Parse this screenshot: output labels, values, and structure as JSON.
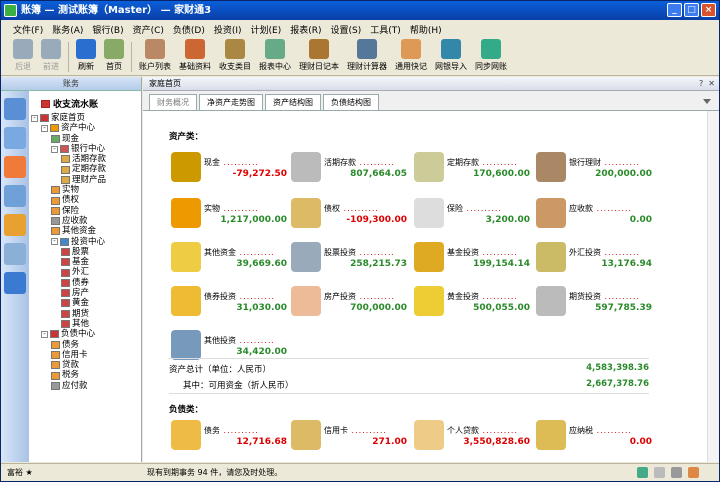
{
  "window": {
    "title": "账簿 — 测试账簿（Master） — 家财通3"
  },
  "menu": [
    "文件(F)",
    "账务(A)",
    "银行(B)",
    "资产(C)",
    "负债(D)",
    "投资(I)",
    "计划(E)",
    "报表(R)",
    "设置(S)",
    "工具(T)",
    "帮助(H)"
  ],
  "toolbar": [
    {
      "label": "后退",
      "icon": "back-arrow-icon",
      "enabled": false
    },
    {
      "label": "前进",
      "icon": "forward-arrow-icon",
      "enabled": false
    },
    {
      "label": "刷新",
      "icon": "refresh-icon",
      "enabled": true
    },
    {
      "label": "首页",
      "icon": "home-icon",
      "enabled": true
    },
    {
      "label": "账户列表",
      "icon": "account-list-icon",
      "enabled": true
    },
    {
      "label": "基础资料",
      "icon": "basic-data-icon",
      "enabled": true
    },
    {
      "label": "收支类目",
      "icon": "category-icon",
      "enabled": true
    },
    {
      "label": "报表中心",
      "icon": "report-icon",
      "enabled": true
    },
    {
      "label": "理财日记本",
      "icon": "diary-icon",
      "enabled": true
    },
    {
      "label": "理财计算器",
      "icon": "calculator-icon",
      "enabled": true
    },
    {
      "label": "通用快记",
      "icon": "quick-note-icon",
      "enabled": true
    },
    {
      "label": "网银导入",
      "icon": "netbank-icon",
      "enabled": true
    },
    {
      "label": "同步网账",
      "icon": "sync-icon",
      "enabled": true
    }
  ],
  "left": {
    "header": "账务",
    "journal": "收支流水账",
    "tree": [
      {
        "label": "家庭首页",
        "level": 0,
        "box": "-",
        "color": "#c33"
      },
      {
        "label": "资产中心",
        "level": 1,
        "box": "-",
        "color": "#e90"
      },
      {
        "label": "现金",
        "level": 2,
        "box": "",
        "color": "#6a6"
      },
      {
        "label": "银行中心",
        "level": 2,
        "box": "-",
        "color": "#c55"
      },
      {
        "label": "活期存款",
        "level": 3,
        "box": "",
        "color": "#da4"
      },
      {
        "label": "定期存款",
        "level": 3,
        "box": "",
        "color": "#da4"
      },
      {
        "label": "理财产品",
        "level": 3,
        "box": "",
        "color": "#da4"
      },
      {
        "label": "实物",
        "level": 2,
        "box": "",
        "color": "#e93"
      },
      {
        "label": "债权",
        "level": 2,
        "box": "",
        "color": "#e93"
      },
      {
        "label": "保险",
        "level": 2,
        "box": "",
        "color": "#e93"
      },
      {
        "label": "应收款",
        "level": 2,
        "box": "",
        "color": "#999"
      },
      {
        "label": "其他资金",
        "level": 2,
        "box": "",
        "color": "#e93"
      },
      {
        "label": "投资中心",
        "level": 2,
        "box": "-",
        "color": "#48c"
      },
      {
        "label": "股票",
        "level": 3,
        "box": "",
        "color": "#c44"
      },
      {
        "label": "基金",
        "level": 3,
        "box": "",
        "color": "#c44"
      },
      {
        "label": "外汇",
        "level": 3,
        "box": "",
        "color": "#c44"
      },
      {
        "label": "债券",
        "level": 3,
        "box": "",
        "color": "#c44"
      },
      {
        "label": "房产",
        "level": 3,
        "box": "",
        "color": "#c44"
      },
      {
        "label": "黄金",
        "level": 3,
        "box": "",
        "color": "#c44"
      },
      {
        "label": "期货",
        "level": 3,
        "box": "",
        "color": "#c44"
      },
      {
        "label": "其他",
        "level": 3,
        "box": "",
        "color": "#c44"
      },
      {
        "label": "负债中心",
        "level": 1,
        "box": "-",
        "color": "#c33"
      },
      {
        "label": "债务",
        "level": 2,
        "box": "",
        "color": "#e93"
      },
      {
        "label": "信用卡",
        "level": 2,
        "box": "",
        "color": "#e93"
      },
      {
        "label": "贷款",
        "level": 2,
        "box": "",
        "color": "#e93"
      },
      {
        "label": "税务",
        "level": 2,
        "box": "",
        "color": "#e93"
      },
      {
        "label": "应付款",
        "level": 2,
        "box": "",
        "color": "#999"
      }
    ]
  },
  "main": {
    "header": "家庭首页",
    "tabs": [
      "财务概况",
      "净资产走势图",
      "资产结构图",
      "负债结构图"
    ],
    "asset_section": "资产类：",
    "assets": [
      {
        "name": "现金",
        "value": "-79,272.50",
        "neg": true,
        "color": "#c90"
      },
      {
        "name": "活期存款",
        "value": "807,664.05",
        "neg": false,
        "color": "#bbb"
      },
      {
        "name": "定期存款",
        "value": "170,600.00",
        "neg": false,
        "color": "#cc9"
      },
      {
        "name": "银行理财",
        "value": "200,000.00",
        "neg": false,
        "color": "#a86"
      },
      {
        "name": "实物",
        "value": "1,217,000.00",
        "neg": false,
        "color": "#e90"
      },
      {
        "name": "债权",
        "value": "-109,300.00",
        "neg": true,
        "color": "#db6"
      },
      {
        "name": "保险",
        "value": "3,200.00",
        "neg": false,
        "color": "#ddd"
      },
      {
        "name": "应收款",
        "value": "0.00",
        "neg": false,
        "color": "#c96"
      },
      {
        "name": "其他资金",
        "value": "39,669.60",
        "neg": false,
        "color": "#ec4"
      },
      {
        "name": "股票投资",
        "value": "258,215.73",
        "neg": false,
        "color": "#9ab"
      },
      {
        "name": "基金投资",
        "value": "199,154.14",
        "neg": false,
        "color": "#da2"
      },
      {
        "name": "外汇投资",
        "value": "13,176.94",
        "neg": false,
        "color": "#cb6"
      },
      {
        "name": "债券投资",
        "value": "31,030.00",
        "neg": false,
        "color": "#eb3"
      },
      {
        "name": "房产投资",
        "value": "700,000.00",
        "neg": false,
        "color": "#eb9"
      },
      {
        "name": "黄金投资",
        "value": "500,055.00",
        "neg": false,
        "color": "#ec3"
      },
      {
        "name": "期货投资",
        "value": "597,785.39",
        "neg": false,
        "color": "#bbb"
      },
      {
        "name": "其他投资",
        "value": "34,420.00",
        "neg": false,
        "color": "#79b"
      }
    ],
    "total_label": "资产总计（单位：人民币）",
    "total_value": "4,583,398.36",
    "available_label": "其中：可用资金（折人民币）",
    "available_value": "2,667,378.76",
    "liab_section": "负债类：",
    "liabilities": [
      {
        "name": "债务",
        "value": "12,716.68",
        "color": "#eb4"
      },
      {
        "name": "信用卡",
        "value": "271.00",
        "color": "#db6"
      },
      {
        "name": "个人贷款",
        "value": "3,550,828.60",
        "color": "#ec8"
      },
      {
        "name": "应纳税",
        "value": "0.00",
        "color": "#db5"
      }
    ]
  },
  "status": {
    "user": "富裕 ★",
    "message": "现有到期事务 94 件，请您及时处理。"
  }
}
